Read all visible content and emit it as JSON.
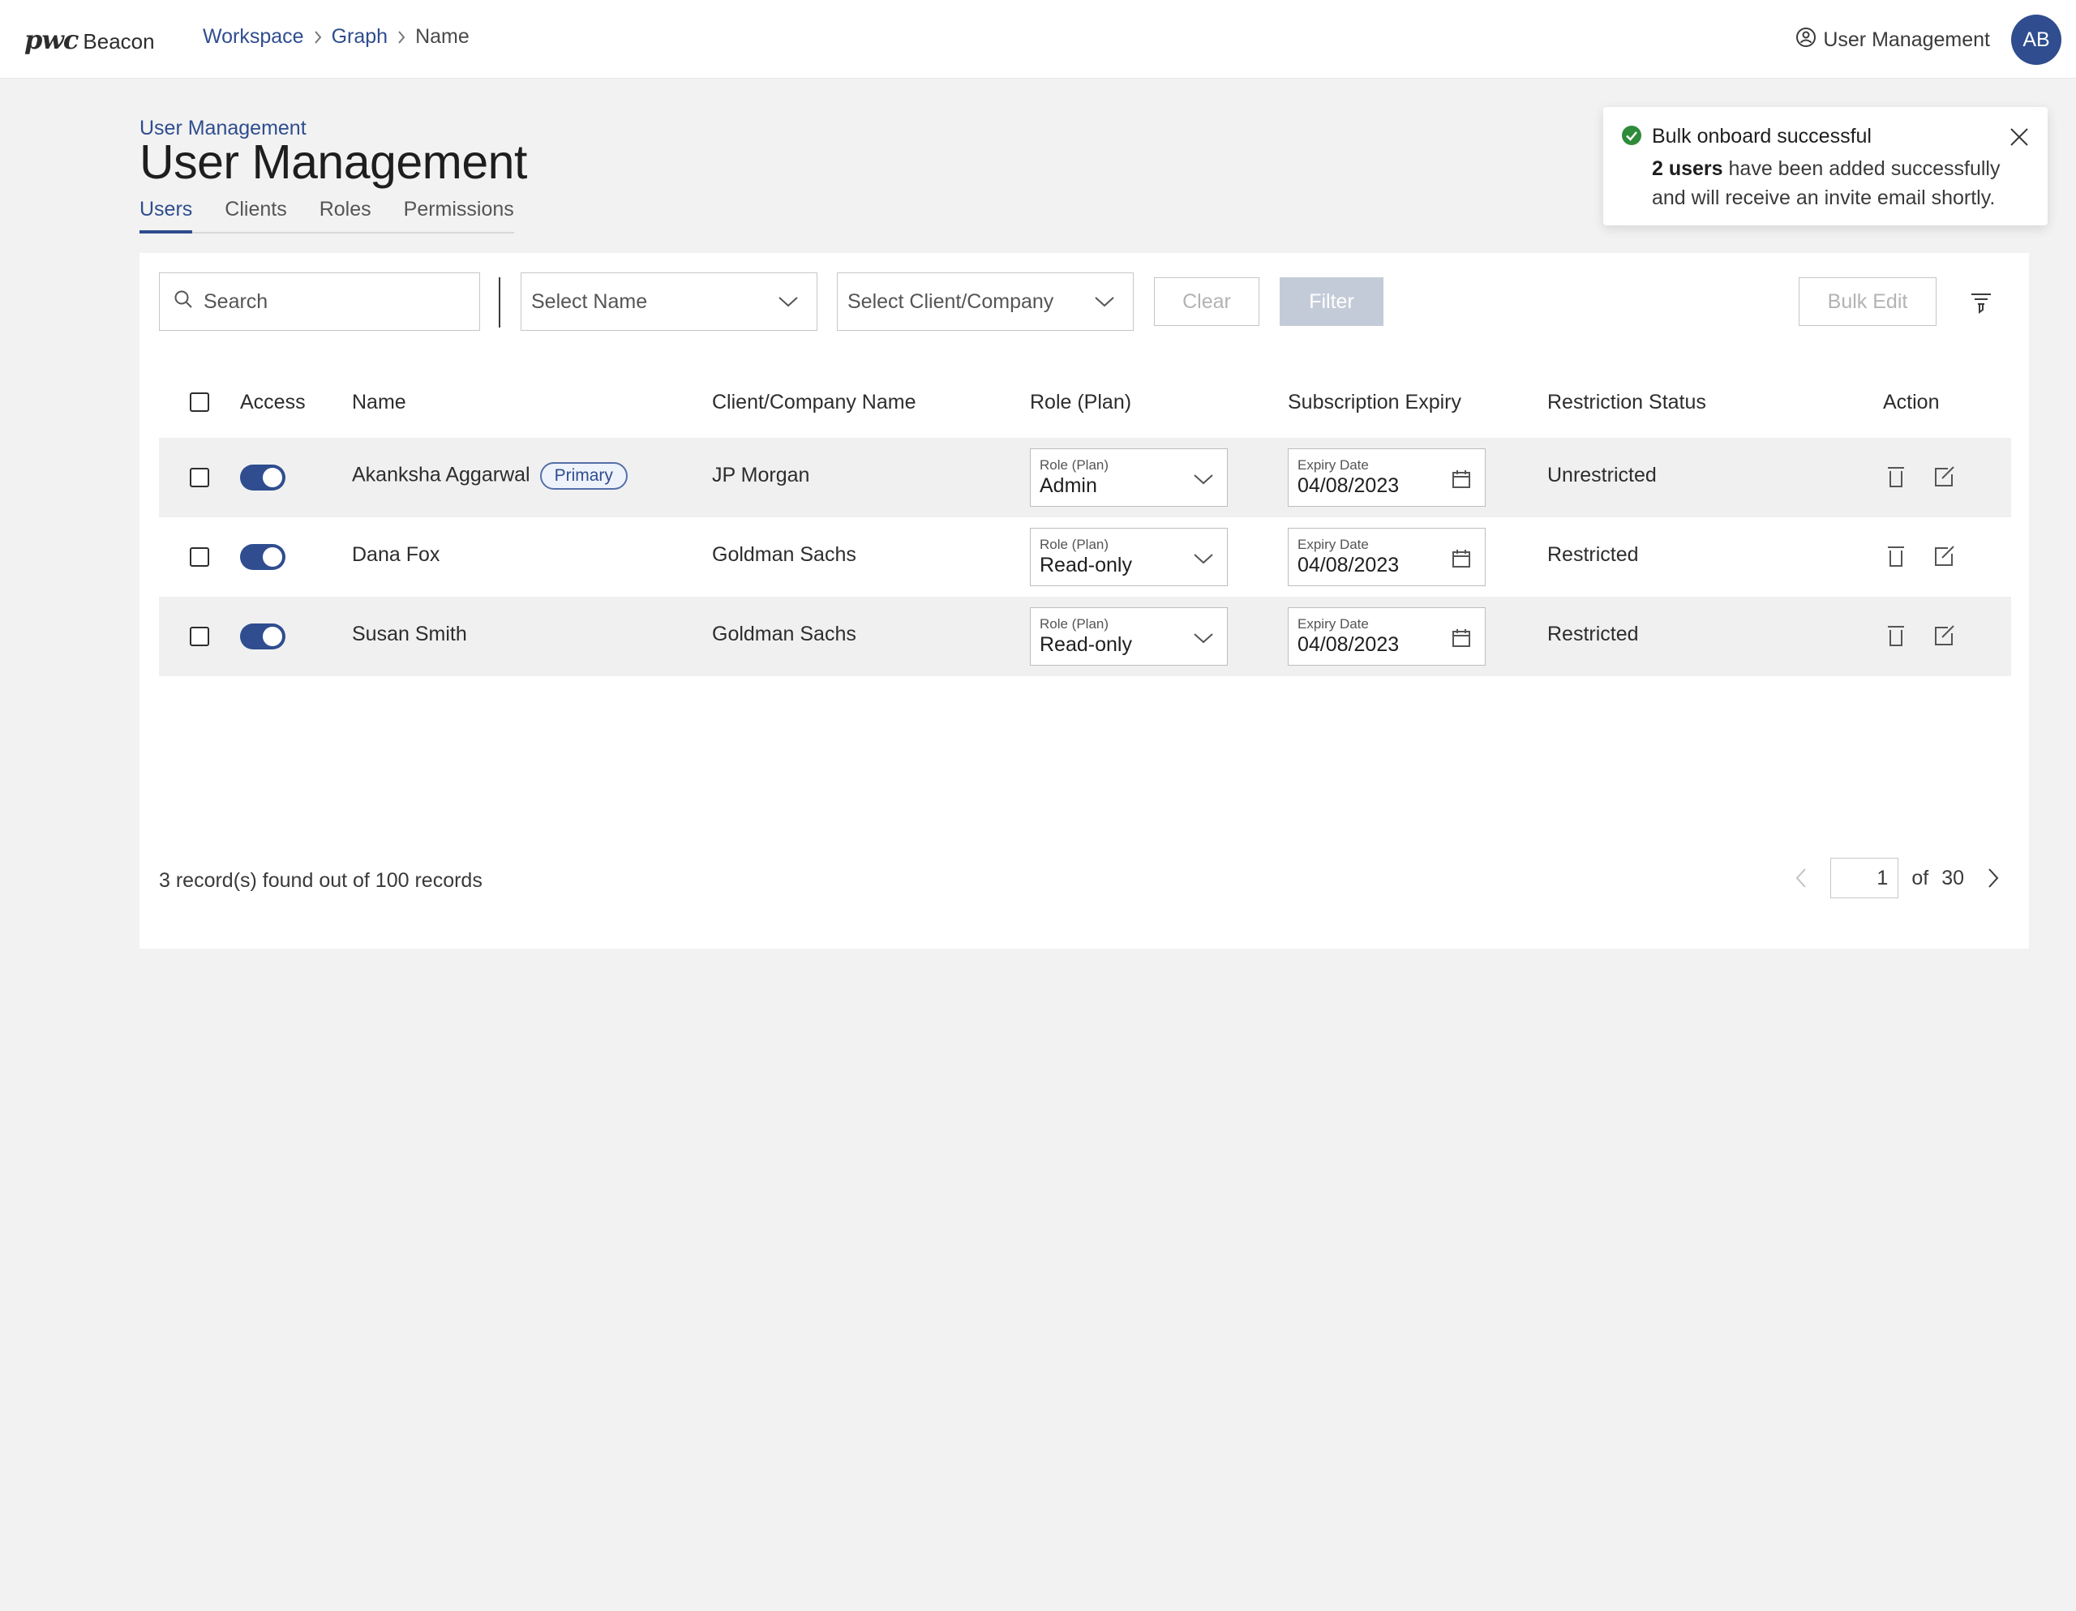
{
  "brand": {
    "mark": "pwc",
    "name": "Beacon"
  },
  "breadcrumb": {
    "items": [
      "Workspace",
      "Graph"
    ],
    "current": "Name"
  },
  "header_right": {
    "link_label": "User Management",
    "avatar_initials": "AB"
  },
  "page": {
    "kicker": "User Management",
    "title": "User Management",
    "tabs": [
      "Users",
      "Clients",
      "Roles",
      "Permissions"
    ],
    "active_tab": "Users"
  },
  "toolbar": {
    "search_placeholder": "Search",
    "select_name_placeholder": "Select Name",
    "select_client_placeholder": "Select Client/Company",
    "clear_label": "Clear",
    "filter_label": "Filter",
    "bulk_edit_label": "Bulk Edit"
  },
  "table": {
    "columns": [
      "Access",
      "Name",
      "Client/Company Name",
      "Role (Plan)",
      "Subscription Expiry",
      "Restriction Status",
      "Action"
    ],
    "role_field_label": "Role (Plan)",
    "expiry_field_label": "Expiry Date",
    "rows": [
      {
        "name": "Akanksha Aggarwal",
        "badge": "Primary",
        "company": "JP Morgan",
        "role": "Admin",
        "expiry": "04/08/2023",
        "status": "Unrestricted"
      },
      {
        "name": "Dana Fox",
        "badge": "",
        "company": "Goldman Sachs",
        "role": "Read-only",
        "expiry": "04/08/2023",
        "status": "Restricted"
      },
      {
        "name": "Susan Smith",
        "badge": "",
        "company": "Goldman Sachs",
        "role": "Read-only",
        "expiry": "04/08/2023",
        "status": "Restricted"
      }
    ]
  },
  "footer": {
    "records_text": "3 record(s) found out of 100 records",
    "page_current": "1",
    "page_of": "of",
    "page_total": "30"
  },
  "toast": {
    "title": "Bulk onboard successful",
    "body_bold": "2 users",
    "body_line1": " have been added successfully",
    "body_line2": "and will receive an invite email shortly."
  },
  "colors": {
    "accent": "#2f4d8f",
    "success": "#2e8b3a",
    "row_shade": "#f0f0f0"
  }
}
